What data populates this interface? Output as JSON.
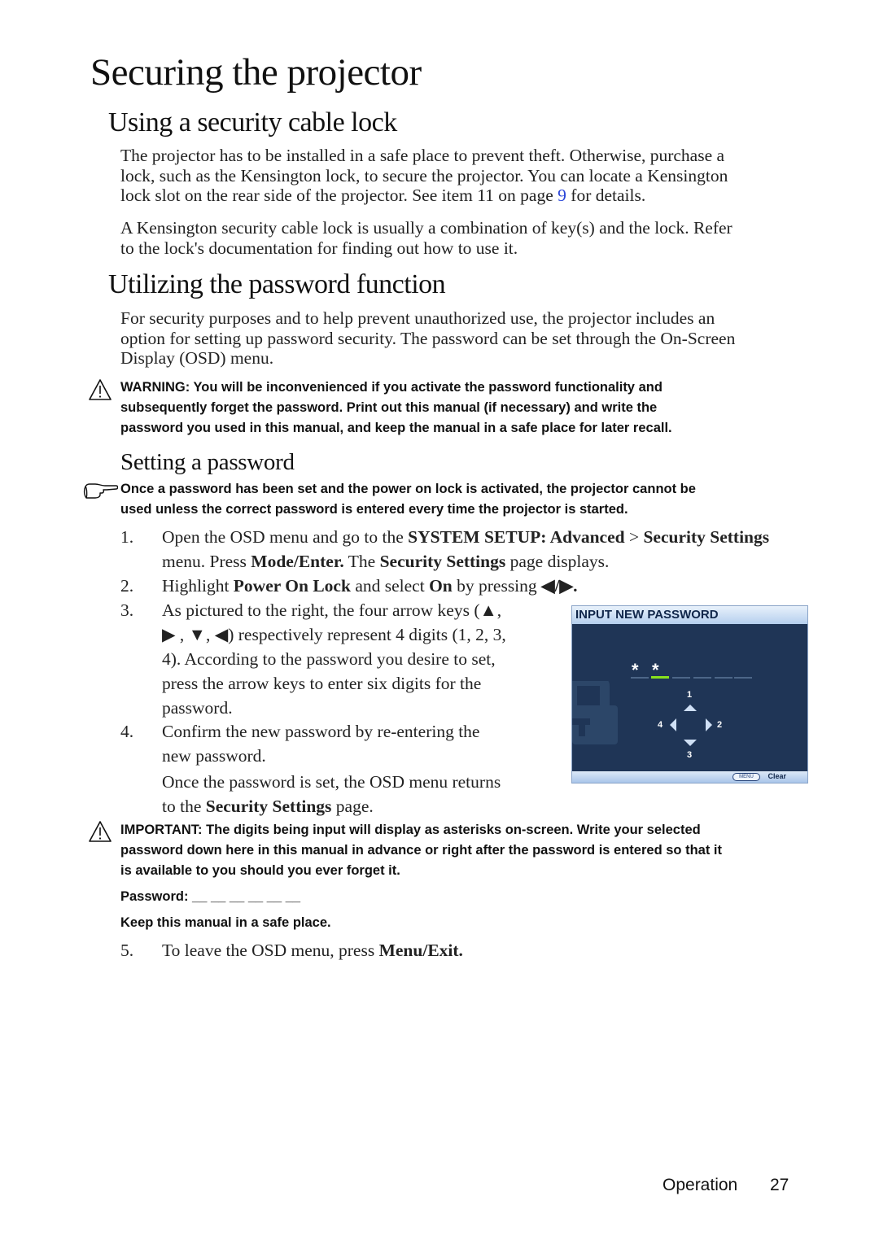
{
  "page": {
    "title": "Securing the projector",
    "sections": {
      "cable_lock": {
        "heading": "Using a security cable lock",
        "para1_parts": {
          "line1": "The projector has to be installed in a safe place to prevent theft. Otherwise, purchase a",
          "line2": "lock, such as the Kensington lock, to secure the projector. You can locate a Kensington",
          "line3_before": "lock slot on the rear side of the projector. See item 11 on page ",
          "line3_link": "9",
          "line3_after": " for details."
        },
        "para2_line1": "A Kensington security cable lock is usually a combination of key(s) and the lock. Refer",
        "para2_line2": "to the lock's documentation for finding out how to use it."
      },
      "password": {
        "heading": "Utilizing the password function",
        "intro_line1": "For security purposes and to help prevent unauthorized use, the projector includes an",
        "intro_line2": "option for setting up password security. The password can be set through the On-Screen",
        "intro_line3": "Display (OSD) menu.",
        "warning_line1": "WARNING: You will be inconvenienced if you activate the password functionality and",
        "warning_line2": "subsequently forget the password. Print out this manual (if necessary) and write the",
        "warning_line3": "password you used in this manual, and keep the manual in a safe place for later recall."
      },
      "setting": {
        "heading": "Setting a password",
        "tip_line1": "Once a password has been set and the power on lock is activated, the projector cannot be",
        "tip_line2": "used unless the correct password is entered every time the projector is started.",
        "steps": [
          {
            "num": "1.",
            "l1_a": "Open the OSD menu and go to the ",
            "l1_b": "SYSTEM SETUP: Advanced",
            "l1_c": " > ",
            "l1_d": "Security Settings",
            "l2_a": "menu. Press ",
            "l2_b": "Mode/Enter.",
            "l2_c": " The ",
            "l2_d": "Security Settings",
            "l2_e": " page displays."
          },
          {
            "num": "2.",
            "a": "Highlight ",
            "b": "Power On Lock",
            "c": " and select ",
            "d": "On",
            "e": " by pressing ",
            "f": "◀/▶."
          },
          {
            "num": "3.",
            "l1": "As pictured to the right, the four arrow keys (▲,",
            "l2": "▶ , ▼, ◀) respectively represent 4 digits (1, 2, 3,",
            "l3": "4). According to the password you desire to set,",
            "l4": "press the arrow keys to enter six digits for the",
            "l5": "password."
          },
          {
            "num": "4.",
            "l1": "Confirm the new password by re-entering the",
            "l2": "new password.",
            "l3": "Once the password is set, the OSD menu returns",
            "l4_a": "to the ",
            "l4_b": "Security Settings",
            "l4_c": " page."
          },
          {
            "num": "5.",
            "a": "To leave the OSD menu, press ",
            "b": "Menu/Exit."
          }
        ],
        "important_line1": "IMPORTANT: The digits being input will display as asterisks on-screen. Write your selected",
        "important_line2": "password down here in this manual in advance or right after the password is entered so that it",
        "important_line3": "is available to you should you ever forget it.",
        "password_label": "Password: __ __ __ __ __ __",
        "keep_safe": "Keep this manual in a safe place."
      }
    },
    "osd": {
      "title": "INPUT NEW PASSWORD",
      "entered": [
        "*",
        "*"
      ],
      "slots_total": 6,
      "active_slot": 2,
      "digits": {
        "up": "1",
        "right": "2",
        "down": "3",
        "left": "4"
      },
      "menu_key": "MENU",
      "clear_label": "Clear",
      "colors": {
        "panel": "#1f3556",
        "active_slot": "#88e21d"
      }
    },
    "footer": {
      "section": "Operation",
      "page_number": "27"
    }
  }
}
